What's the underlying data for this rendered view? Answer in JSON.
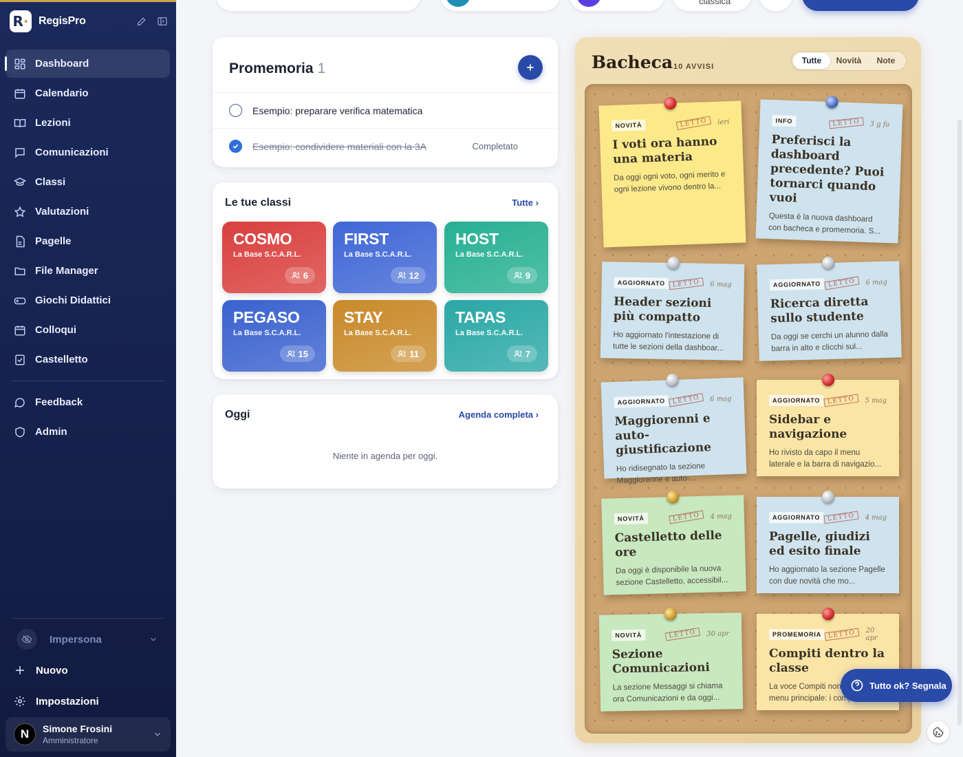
{
  "brand": {
    "name": "RegisPro"
  },
  "sidebar": {
    "items": [
      {
        "label": "Dashboard",
        "icon": "grid-icon",
        "active": true
      },
      {
        "label": "Calendario",
        "icon": "calendar-icon"
      },
      {
        "label": "Lezioni",
        "icon": "book-icon"
      },
      {
        "label": "Comunicazioni",
        "icon": "chat-icon"
      },
      {
        "label": "Classi",
        "icon": "graduation-cap-icon"
      },
      {
        "label": "Valutazioni",
        "icon": "star-icon"
      },
      {
        "label": "Pagelle",
        "icon": "document-icon"
      },
      {
        "label": "File Manager",
        "icon": "folder-icon"
      },
      {
        "label": "Giochi Didattici",
        "icon": "gamepad-icon"
      },
      {
        "label": "Colloqui",
        "icon": "calendar-icon"
      },
      {
        "label": "Castelletto",
        "icon": "checklist-icon"
      }
    ],
    "secondary": [
      {
        "label": "Feedback",
        "icon": "chat-icon"
      },
      {
        "label": "Admin",
        "icon": "shield-icon"
      }
    ],
    "impersona": "Impersona",
    "nuovo": "Nuovo",
    "impostazioni": "Impostazioni",
    "user": {
      "initial": "N",
      "name": "Simone Frosini",
      "role": "Amministratore"
    }
  },
  "topbar": {
    "partial_label": "classica"
  },
  "promemoria": {
    "title": "Promemoria",
    "count": "1",
    "items": [
      {
        "text": "Esempio: preparare verifica matematica",
        "done": false
      },
      {
        "text": "Esempio: condividere materiali con la 3A",
        "done": true,
        "status": "Completato"
      }
    ]
  },
  "classi": {
    "title": "Le tue classi",
    "link": "Tutte",
    "tiles": [
      {
        "name": "COSMO",
        "school": "La Base S.C.A.R.L.",
        "count": "6",
        "color": "#d9403e"
      },
      {
        "name": "FIRST",
        "school": "La Base S.C.A.R.L.",
        "count": "12",
        "color": "#3f67d6"
      },
      {
        "name": "HOST",
        "school": "La Base S.C.A.R.L.",
        "count": "9",
        "color": "#27b092"
      },
      {
        "name": "PEGASO",
        "school": "La Base S.C.A.R.L.",
        "count": "15",
        "color": "#3a62cf"
      },
      {
        "name": "STAY",
        "school": "La Base S.C.A.R.L.",
        "count": "11",
        "color": "#c98a2a"
      },
      {
        "name": "TAPAS",
        "school": "La Base S.C.A.R.L.",
        "count": "7",
        "color": "#2aa8a6"
      }
    ]
  },
  "oggi": {
    "title": "Oggi",
    "link": "Agenda completa",
    "empty": "Niente in agenda per oggi."
  },
  "bacheca": {
    "title": "Bacheca",
    "count": "10 AVVISI",
    "filters": [
      "Tutte",
      "Novità",
      "Note"
    ],
    "notes": [
      {
        "tag": "NOVITÀ",
        "letto": "LETTO",
        "when": "ieri",
        "title": "I voti ora hanno una materia",
        "desc": "Da oggi ogni voto, ogni merito e ogni lezione vivono dentro la...",
        "color": "yellow",
        "pin": "red"
      },
      {
        "tag": "INFO",
        "letto": "LETTO",
        "when": "3 g fa",
        "title": "Preferisci la dashboard precedente? Puoi tornarci quando vuoi",
        "desc": "Questa è la nuova dashboard con bacheca e promemoria. S...",
        "color": "blue",
        "pin": "navy"
      },
      {
        "tag": "AGGIORNATO",
        "letto": "LETTO",
        "when": "6 mag",
        "title": "Header sezioni più compatto",
        "desc": "Ho aggiornato l'intestazione di tutte le sezioni della dashboar...",
        "color": "blue",
        "pin": "silver"
      },
      {
        "tag": "AGGIORNATO",
        "letto": "LETTO",
        "when": "6 mag",
        "title": "Ricerca diretta sullo studente",
        "desc": "Da oggi se cerchi un alunno dalla barra in alto e clicchi sul...",
        "color": "blue",
        "pin": "silver"
      },
      {
        "tag": "AGGIORNATO",
        "letto": "LETTO",
        "when": "6 mag",
        "title": "Maggiorenni e auto-giustificazione",
        "desc": "Ho ridisegnato la sezione Maggiorenne e auto-...",
        "color": "blue",
        "pin": "silver"
      },
      {
        "tag": "AGGIORNATO",
        "letto": "LETTO",
        "when": "5 mag",
        "title": "Sidebar e navigazione",
        "desc": "Ho rivisto da capo il menu laterale e la barra di navigazio...",
        "color": "cream",
        "pin": "red"
      },
      {
        "tag": "NOVITÀ",
        "letto": "LETTO",
        "when": "4 mag",
        "title": "Castelletto delle ore",
        "desc": "Da oggi è disponibile la nuova sezione Castelletto, accessibil...",
        "color": "green",
        "pin": "gold"
      },
      {
        "tag": "AGGIORNATO",
        "letto": "LETTO",
        "when": "4 mag",
        "title": "Pagelle, giudizi ed esito finale",
        "desc": "Ho aggiornato la sezione Pagelle con due novità che mo...",
        "color": "blue",
        "pin": "silver"
      },
      {
        "tag": "NOVITÀ",
        "letto": "LETTO",
        "when": "30 apr",
        "title": "Sezione Comunicazioni",
        "desc": "La sezione Messaggi si chiama ora Comunicazioni e da oggi...",
        "color": "green",
        "pin": "gold"
      },
      {
        "tag": "PROMEMORIA",
        "letto": "LETTO",
        "when": "20 apr",
        "title": "Compiti dentro la classe",
        "desc": "La voce Compiti non è più nel menu principale: i compiti...",
        "color": "cream",
        "pin": "red"
      }
    ]
  },
  "fab": {
    "label": "Tutto ok? Segnala"
  }
}
